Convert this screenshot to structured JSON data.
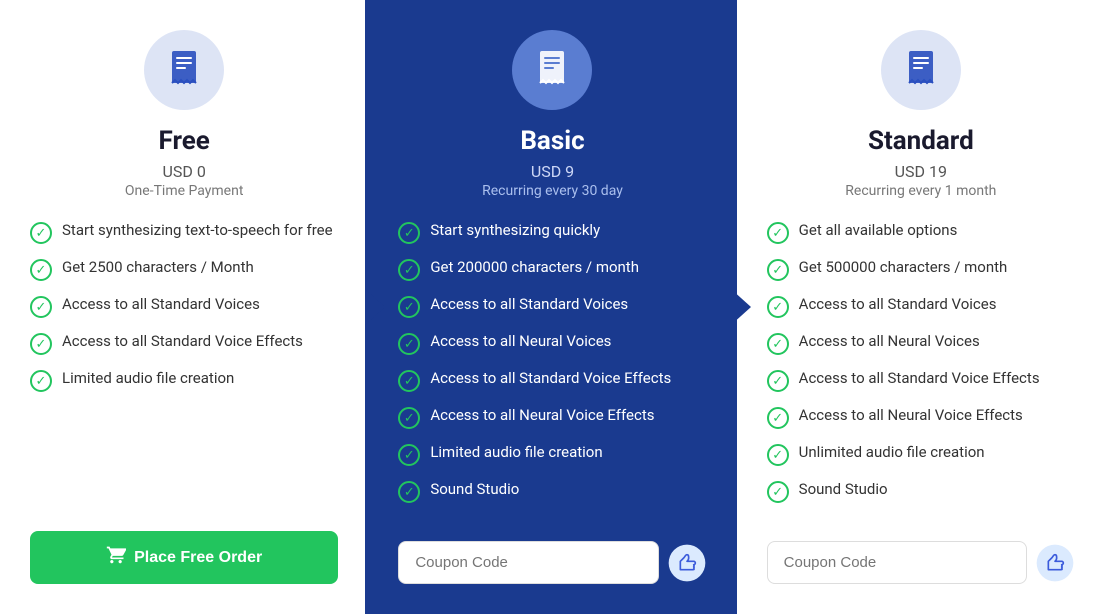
{
  "plans": [
    {
      "id": "free",
      "name": "Free",
      "price": "USD 0",
      "billing": "One-Time Payment",
      "highlighted": false,
      "features": [
        "Start synthesizing text-to-speech for free",
        "Get 2500 characters / Month",
        "Access to all Standard Voices",
        "Access to all Standard Voice Effects",
        "Limited audio file creation"
      ],
      "cta_label": "Place Free Order",
      "cta_type": "button"
    },
    {
      "id": "basic",
      "name": "Basic",
      "price": "USD 9",
      "billing": "Recurring every 30 day",
      "highlighted": true,
      "features": [
        "Start synthesizing quickly",
        "Get 200000 characters / month",
        "Access to all Standard Voices",
        "Access to all Neural Voices",
        "Access to all Standard Voice Effects",
        "Access to all Neural Voice Effects",
        "Limited audio file creation",
        "Sound Studio"
      ],
      "cta_label": "Coupon Code",
      "cta_type": "coupon"
    },
    {
      "id": "standard",
      "name": "Standard",
      "price": "USD 19",
      "billing": "Recurring every 1 month",
      "highlighted": false,
      "features": [
        "Get all available options",
        "Get 500000 characters / month",
        "Access to all Standard Voices",
        "Access to all Neural Voices",
        "Access to all Standard Voice Effects",
        "Access to all Neural Voice Effects",
        "Unlimited audio file creation",
        "Sound Studio"
      ],
      "cta_label": "Coupon Code",
      "cta_type": "coupon"
    }
  ],
  "icon_symbol": "🧾",
  "check_symbol": "✓",
  "cart_symbol": "🛒",
  "coupon_icon": "👍"
}
